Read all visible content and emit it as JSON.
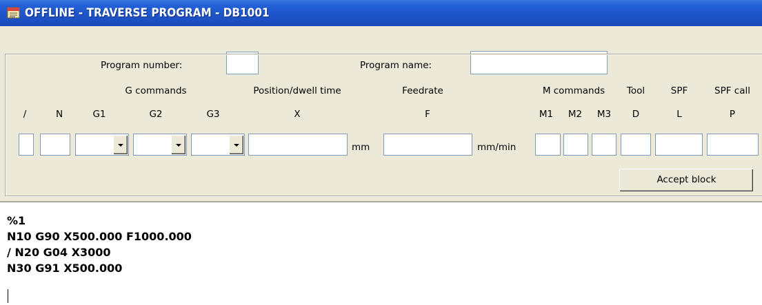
{
  "window": {
    "title": "OFFLINE - TRAVERSE PROGRAM - DB1001",
    "title_bar_color": "#1f55c9",
    "icon": "notepad-app-icon"
  },
  "header": {
    "program_number_label": "Program number:",
    "program_number_value": "",
    "program_name_label": "Program name:",
    "program_name_value": ""
  },
  "columns": {
    "g_commands": "G commands",
    "position_dwell": "Position/dwell time",
    "feedrate": "Feedrate",
    "m_commands": "M commands",
    "tool": "Tool",
    "spf": "SPF",
    "spf_call": "SPF call",
    "slash": "/",
    "n": "N",
    "g1": "G1",
    "g2": "G2",
    "g3": "G3",
    "x": "X",
    "f": "F",
    "m1": "M1",
    "m2": "M2",
    "m3": "M3",
    "d": "D",
    "l": "L",
    "p": "P"
  },
  "inputs": {
    "slash": "",
    "n": "",
    "g1": "",
    "g2": "",
    "g3": "",
    "x": "",
    "f": "",
    "m1": "",
    "m2": "",
    "m3": "",
    "d": "",
    "l": "",
    "p": ""
  },
  "units": {
    "x": "mm",
    "f": "mm/min"
  },
  "buttons": {
    "accept_block": "Accept block"
  },
  "program_lines": [
    "%1",
    "N10 G90 X500.000 F1000.000",
    "/ N20 G04 X3000",
    "N30 G91 X500.000"
  ]
}
